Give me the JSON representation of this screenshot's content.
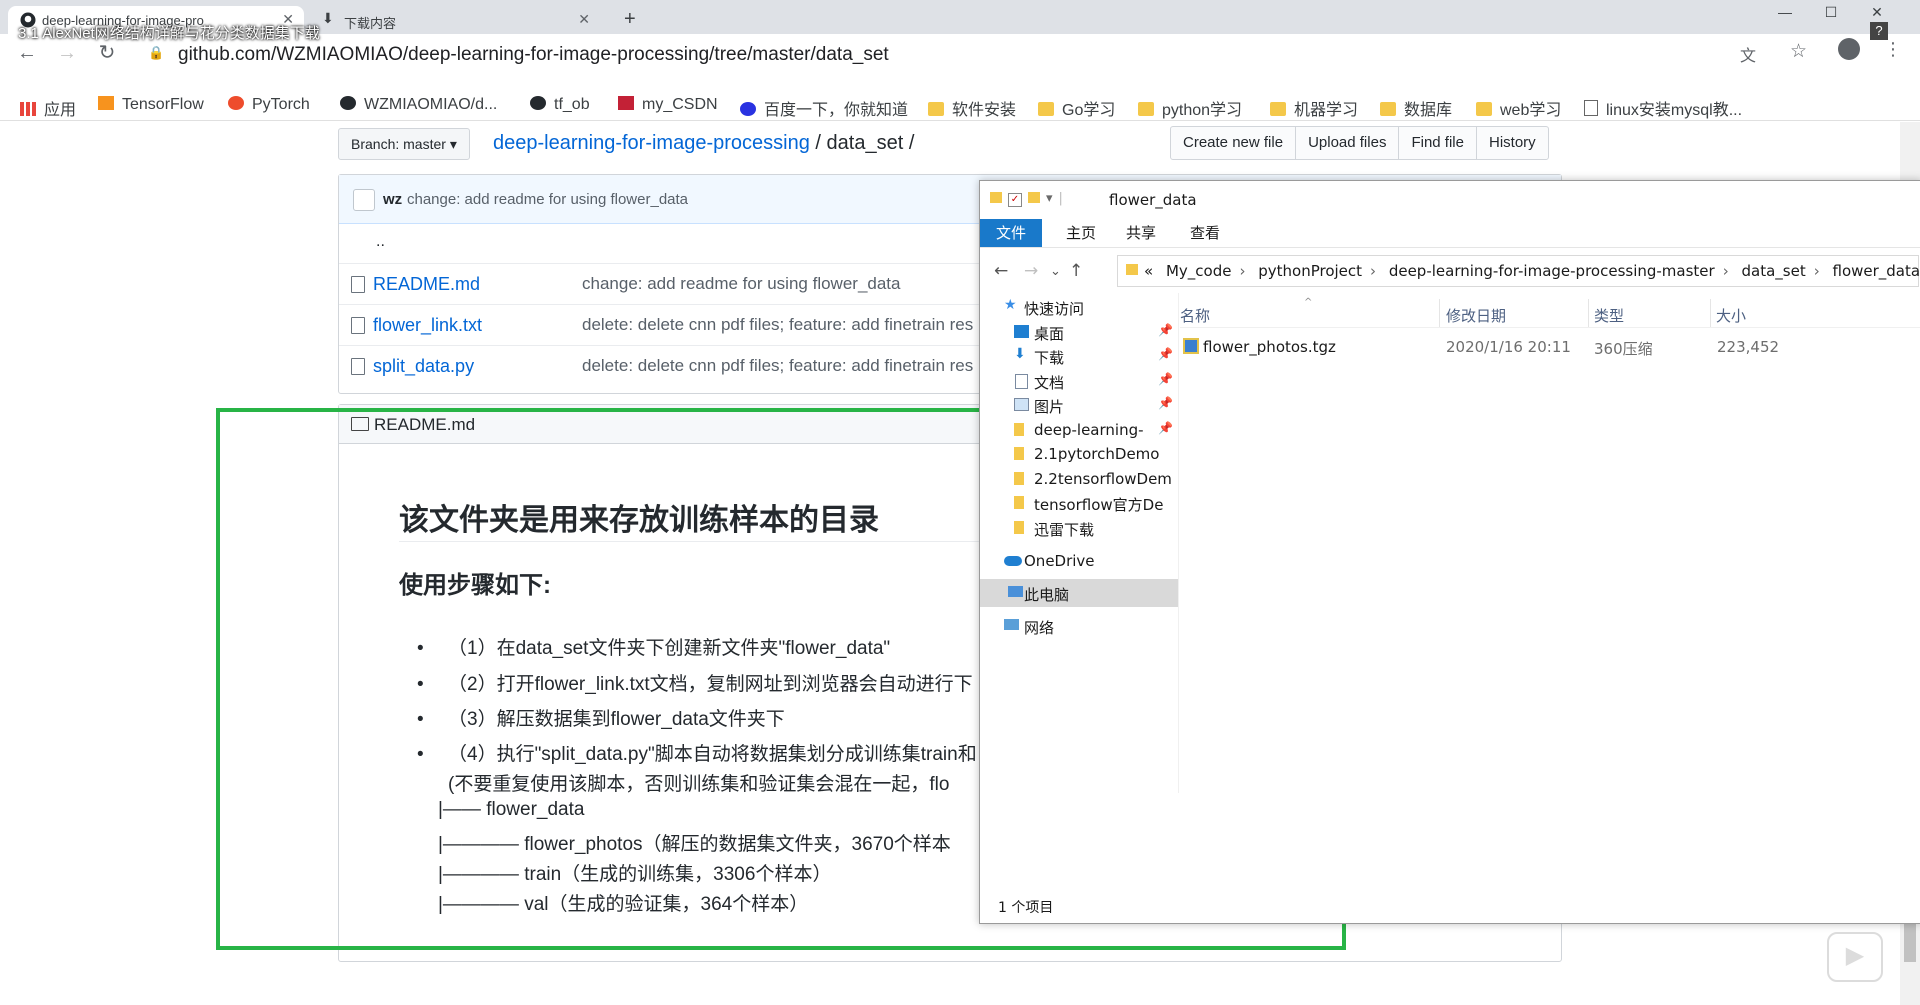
{
  "video_overlay_title": "3.1 AlexNet网络结构详解与花分类数据集下载",
  "browser": {
    "tabs": [
      {
        "title": "deep-learning-for-image-pro",
        "active": true
      },
      {
        "title": "下载内容",
        "active": false
      }
    ],
    "url": "github.com/WZMIAOMIAO/deep-learning-for-image-processing/tree/master/data_set",
    "bookmarks": [
      "应用",
      "TensorFlow",
      "PyTorch",
      "WZMIAOMIAO/d...",
      "tf_ob",
      "my_CSDN",
      "百度一下，你就知道",
      "软件安装",
      "Go学习",
      "python学习",
      "机器学习",
      "数据库",
      "web学习",
      "linux安装mysql教..."
    ]
  },
  "github": {
    "branch_label": "Branch: master",
    "breadcrumb": {
      "repo": "deep-learning-for-image-processing",
      "sep1": "/",
      "folder": "data_set",
      "sep2": "/"
    },
    "buttons": [
      "Create new file",
      "Upload files",
      "Find file",
      "History"
    ],
    "commit": {
      "author": "wz",
      "message": "change: add readme for using flower_data"
    },
    "up_link": "..",
    "files": [
      {
        "name": "README.md",
        "message": "change: add readme for using flower_data"
      },
      {
        "name": "flower_link.txt",
        "message": "delete: delete cnn pdf files; feature: add finetrain res"
      },
      {
        "name": "split_data.py",
        "message": "delete: delete cnn pdf files; feature: add finetrain res"
      }
    ],
    "readme": {
      "title": "README.md",
      "h1": "该文件夹是用来存放训练样本的目录",
      "h2": "使用步骤如下:",
      "items": [
        "（1）在data_set文件夹下创建新文件夹\"flower_data\"",
        "（2）打开flower_link.txt文档，复制网址到浏览器会自动进行下",
        "（3）解压数据集到flower_data文件夹下",
        "（4）执行\"split_data.py\"脚本自动将数据集划分成训练集train和"
      ],
      "item4_cont": "(不要重复使用该脚本，否则训练集和验证集会混在一起，flo",
      "tree": [
        "|—— flower_data",
        "|———— flower_photos（解压的数据集文件夹，3670个样本",
        "|———— train（生成的训练集，3306个样本）",
        "|———— val（生成的验证集，364个样本）"
      ]
    }
  },
  "explorer": {
    "title": "flower_data",
    "ribbon_tabs": [
      "文件",
      "主页",
      "共享",
      "查看"
    ],
    "path": [
      "My_code",
      "pythonProject",
      "deep-learning-for-image-processing-master",
      "data_set",
      "flower_data"
    ],
    "path_prefix": "«",
    "nav": [
      "快速访问",
      "桌面",
      "下载",
      "文档",
      "图片",
      "deep-learning-",
      "2.1pytorchDemo",
      "2.2tensorflowDem",
      "tensorflow官方De",
      "迅雷下载",
      "OneDrive",
      "此电脑",
      "网络"
    ],
    "columns": [
      "名称",
      "修改日期",
      "类型",
      "大小"
    ],
    "files": [
      {
        "name": "flower_photos.tgz",
        "date": "2020/1/16 20:11",
        "type": "360压缩",
        "size": "223,452"
      }
    ],
    "status": "1 个项目"
  },
  "colors": {
    "highlight": "#28b446",
    "link": "#0366d6",
    "ribbon_file": "#1979ca"
  }
}
